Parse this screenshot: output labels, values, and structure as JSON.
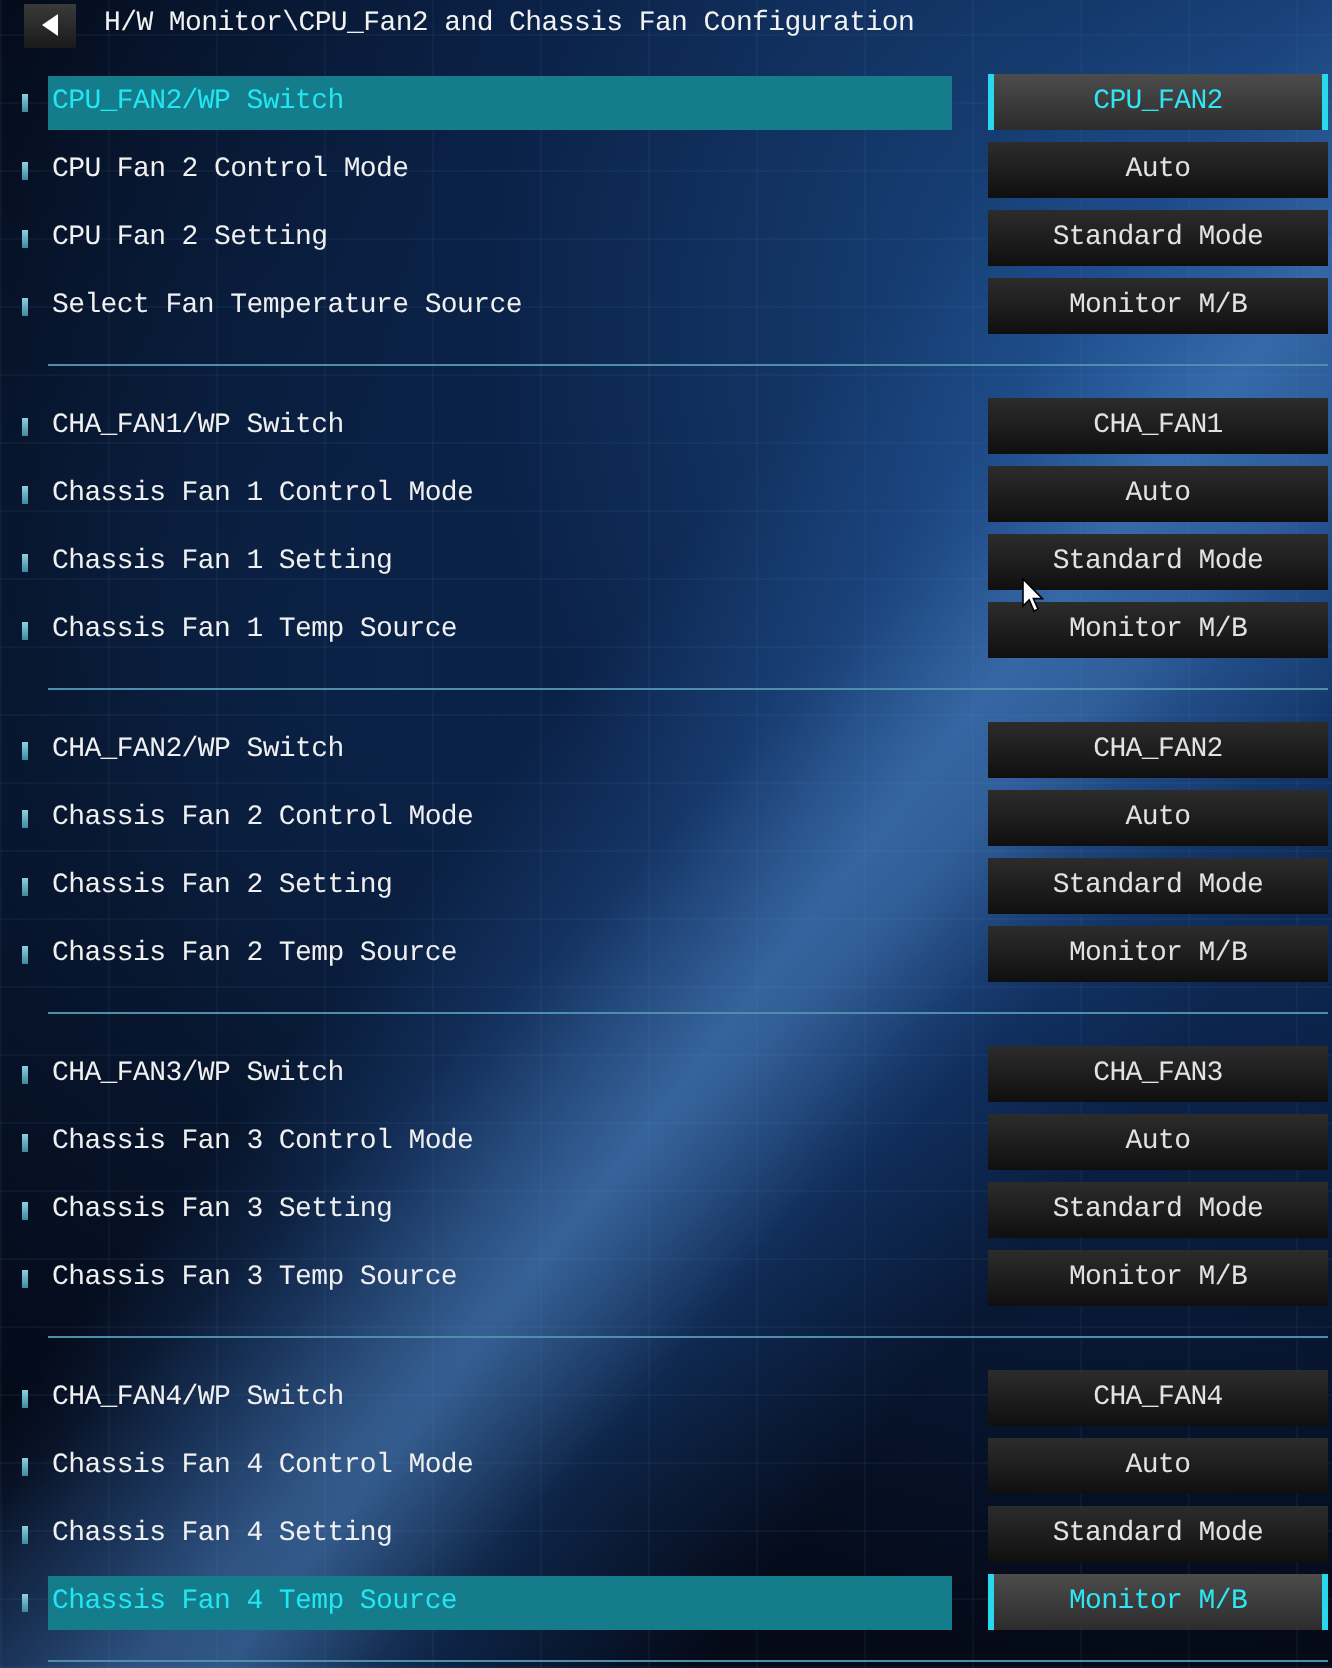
{
  "title_bar": {
    "title": "H/W Monitor\\CPU_Fan2 and Chassis Fan Configuration"
  },
  "groups": [
    {
      "items": [
        {
          "label": "CPU_FAN2/WP Switch",
          "value": "CPU_FAN2",
          "selected": true
        },
        {
          "label": "CPU Fan 2 Control Mode",
          "value": "Auto",
          "selected": false
        },
        {
          "label": "CPU Fan 2 Setting",
          "value": "Standard Mode",
          "selected": false
        },
        {
          "label": "Select Fan Temperature Source",
          "value": "Monitor M/B",
          "selected": false
        }
      ]
    },
    {
      "items": [
        {
          "label": "CHA_FAN1/WP Switch",
          "value": "CHA_FAN1",
          "selected": false
        },
        {
          "label": "Chassis Fan 1 Control Mode",
          "value": "Auto",
          "selected": false
        },
        {
          "label": "Chassis Fan 1 Setting",
          "value": "Standard Mode",
          "selected": false
        },
        {
          "label": "Chassis Fan 1 Temp Source",
          "value": "Monitor M/B",
          "selected": false
        }
      ]
    },
    {
      "items": [
        {
          "label": "CHA_FAN2/WP Switch",
          "value": "CHA_FAN2",
          "selected": false
        },
        {
          "label": "Chassis Fan 2 Control Mode",
          "value": "Auto",
          "selected": false
        },
        {
          "label": "Chassis Fan 2 Setting",
          "value": "Standard Mode",
          "selected": false
        },
        {
          "label": "Chassis Fan 2 Temp Source",
          "value": "Monitor M/B",
          "selected": false
        }
      ]
    },
    {
      "items": [
        {
          "label": "CHA_FAN3/WP Switch",
          "value": "CHA_FAN3",
          "selected": false
        },
        {
          "label": "Chassis Fan 3 Control Mode",
          "value": "Auto",
          "selected": false
        },
        {
          "label": "Chassis Fan 3 Setting",
          "value": "Standard Mode",
          "selected": false
        },
        {
          "label": "Chassis Fan 3 Temp Source",
          "value": "Monitor M/B",
          "selected": false
        }
      ]
    },
    {
      "items": [
        {
          "label": "CHA_FAN4/WP Switch",
          "value": "CHA_FAN4",
          "selected": false
        },
        {
          "label": "Chassis Fan 4 Control Mode",
          "value": "Auto",
          "selected": false
        },
        {
          "label": "Chassis Fan 4 Setting",
          "value": "Standard Mode",
          "selected": false
        },
        {
          "label": "Chassis Fan 4 Temp Source",
          "value": "Monitor M/B",
          "selected": true
        }
      ]
    }
  ]
}
